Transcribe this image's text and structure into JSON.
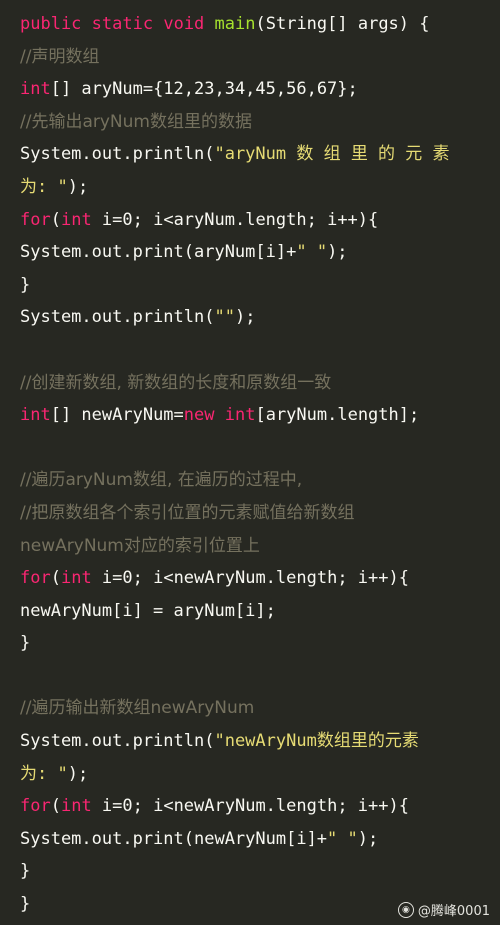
{
  "code": {
    "l1": {
      "kw1": "public",
      "kw2": "static",
      "kw3": "void",
      "fn": "main",
      "rest": "(String[] args) {"
    },
    "l2": {
      "comment": "//声明数组"
    },
    "l3": {
      "kw": "int",
      "rest": "[] aryNum={12,23,34,45,56,67};"
    },
    "l4": {
      "comment": "//先输出aryNum数组里的数据"
    },
    "l5": {
      "pre": "System.out.println(",
      "str": "\"aryNum 数 组 里 的 元 素"
    },
    "l6": {
      "str": "为: \"",
      "rest": ");"
    },
    "l7": {
      "kw1": "for",
      "p1": "(",
      "kw2": "int",
      "rest": " i=0; i<aryNum.length; i++){"
    },
    "l8": {
      "pre": "System.out.print(aryNum[i]+",
      "str": "\" \"",
      "rest": ");"
    },
    "l9": {
      "text": "}"
    },
    "l10": {
      "pre": "System.out.println(",
      "str": "\"\"",
      "rest": ");"
    },
    "l12": {
      "comment": "//创建新数组, 新数组的长度和原数组一致"
    },
    "l13": {
      "kw1": "int",
      "mid": "[] newAryNum=",
      "kw2": "new",
      "sp": " ",
      "kw3": "int",
      "rest": "[aryNum.length];"
    },
    "l15": {
      "comment": "//遍历aryNum数组, 在遍历的过程中,"
    },
    "l16": {
      "comment": "//把原数组各个索引位置的元素赋值给新数组"
    },
    "l17": {
      "comment": "newAryNum对应的索引位置上"
    },
    "l18": {
      "kw1": "for",
      "p1": "(",
      "kw2": "int",
      "rest": " i=0; i<newAryNum.length; i++){"
    },
    "l19": {
      "text": "newAryNum[i] = aryNum[i];"
    },
    "l20": {
      "text": "}"
    },
    "l22": {
      "comment": "//遍历输出新数组newAryNum"
    },
    "l23": {
      "pre": "System.out.println(",
      "str": "\"newAryNum数组里的元素"
    },
    "l24": {
      "str": "为: \"",
      "rest": ");"
    },
    "l25": {
      "kw1": "for",
      "p1": "(",
      "kw2": "int",
      "rest": " i=0; i<newAryNum.length; i++){"
    },
    "l26": {
      "pre": "System.out.print(newAryNum[i]+",
      "str": "\" \"",
      "rest": ");"
    },
    "l27": {
      "text": "}"
    },
    "l28": {
      "text": "}"
    }
  },
  "watermark": {
    "text": "@腾峰0001",
    "icon": "toutiao-logo-icon"
  },
  "colors": {
    "background": "#272822",
    "keyword": "#f92672",
    "function": "#a6e22e",
    "string": "#e6db74",
    "comment": "#75715e",
    "text": "#f8f8f2"
  }
}
